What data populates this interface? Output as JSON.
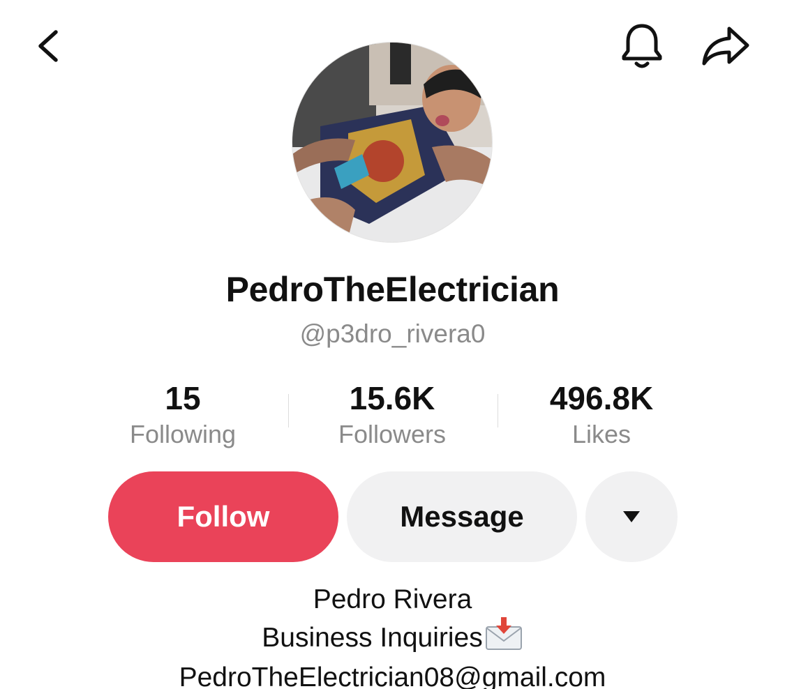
{
  "header": {
    "back_icon": "chevron-left-icon",
    "bell_icon": "bell-icon",
    "share_icon": "share-arrow-icon"
  },
  "profile": {
    "display_name": "PedroTheElectrician",
    "handle": "@p3dro_rivera0"
  },
  "stats": {
    "following": {
      "value": "15",
      "label": "Following"
    },
    "followers": {
      "value": "15.6K",
      "label": "Followers"
    },
    "likes": {
      "value": "496.8K",
      "label": "Likes"
    }
  },
  "actions": {
    "follow_label": "Follow",
    "message_label": "Message",
    "more_icon": "triangle-down-icon"
  },
  "bio": {
    "line1": "Pedro Rivera",
    "line2": "Business Inquiries",
    "line2_emoji_icon": "incoming-envelope-icon",
    "line3": "PedroTheElectrician08@gmail.com"
  },
  "colors": {
    "follow_button": "#ea4359",
    "secondary_button": "#f1f1f2",
    "muted_text": "#8a8a8a"
  }
}
